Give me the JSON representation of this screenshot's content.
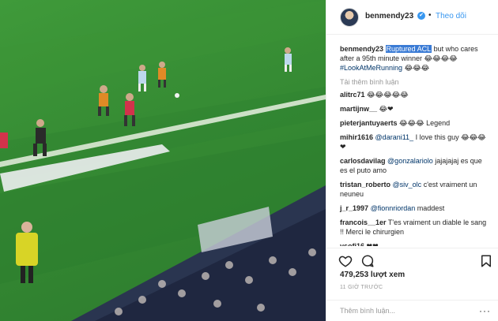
{
  "post": {
    "username": "benmendy23",
    "verified_mark": "✔",
    "follow_separator": "•",
    "follow_label": "Theo dõi"
  },
  "caption": {
    "username": "benmendy23",
    "highlighted": "Ruptured ACL",
    "text": " but who cares after a 95th minute winner 😂😂😂😂",
    "hashtag": "#LookAtMeRunning",
    "emoji_tail": " 😂😂😂"
  },
  "load_more": "Tải thêm bình luận",
  "comments": [
    {
      "user": "alitrc71",
      "mention": "",
      "text": " 😂😂😂😂😂"
    },
    {
      "user": "martijnw__",
      "mention": "",
      "text": " 😂❤"
    },
    {
      "user": "pieterjantuyaerts",
      "mention": "",
      "text": " 😂😂😂 Legend"
    },
    {
      "user": "mihir1616",
      "mention": "@darani11_",
      "text": " I love this guy 😂😂😂❤"
    },
    {
      "user": "carlosdavilag",
      "mention": "@gonzalariolo",
      "text": " jajajajaj es que es el puto amo"
    },
    {
      "user": "tristan_roberto",
      "mention": "@siv_olc",
      "text": " c'est vraiment un neuneu"
    },
    {
      "user": "j_r_1997",
      "mention": "@fionnriordan",
      "text": " maddest"
    },
    {
      "user": "francois__1er",
      "mention": "",
      "text": " T'es vraiment un diable le sang !! Merci le chirurgien"
    },
    {
      "user": "ysofi16",
      "mention": "",
      "text": " ❤❤"
    }
  ],
  "icons": {
    "like": "heart-icon",
    "comment": "comment-bubble-icon",
    "save": "bookmark-icon",
    "more": "more-options-icon"
  },
  "likes": "479,253 lượt xem",
  "timestamp": "11 GIỜ TRƯỚC",
  "add_comment": {
    "placeholder": "Thêm bình luận...",
    "more_glyph": "···"
  },
  "colors": {
    "pitch": "#358a33",
    "link": "#3897f0",
    "highlight": "#3a7bd5",
    "text": "#262626",
    "muted": "#999999"
  }
}
